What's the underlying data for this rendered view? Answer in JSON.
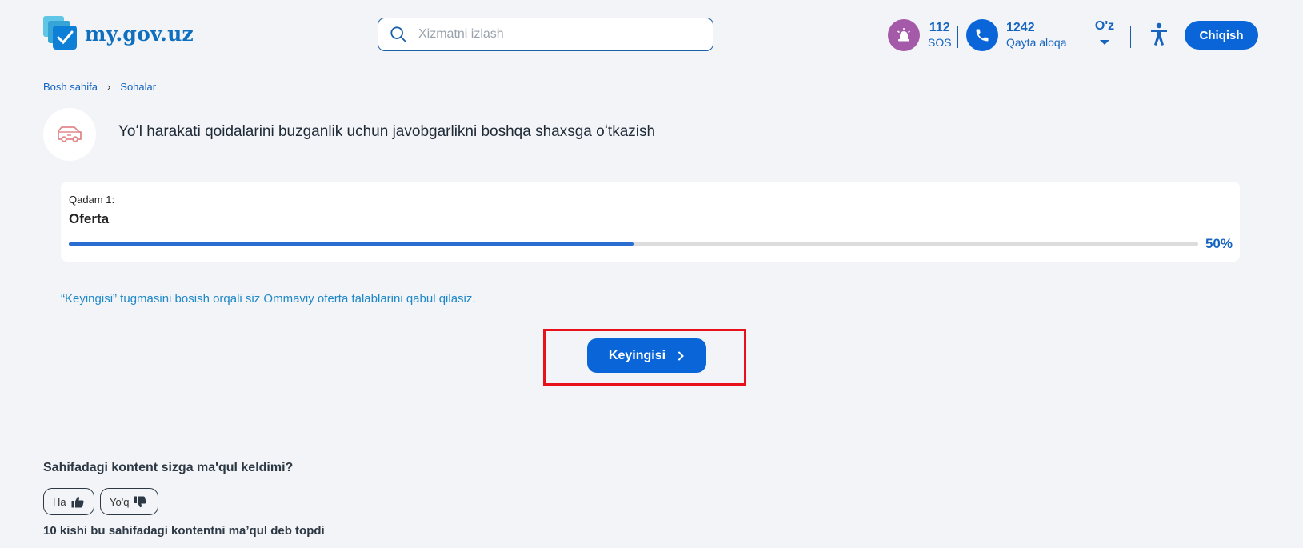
{
  "header": {
    "logo_text": "my.gov.uz",
    "search_placeholder": "Xizmatni izlash",
    "sos": {
      "number": "112",
      "label": "SOS"
    },
    "callback": {
      "number": "1242",
      "label": "Qayta aloqa"
    },
    "language": "O'z",
    "logout_label": "Chiqish"
  },
  "breadcrumb": {
    "home": "Bosh sahifa",
    "section": "Sohalar"
  },
  "page_title": "Yoʻl harakati qoidalarini buzganlik uchun javobgarlikni boshqa shaxsga oʻtkazish",
  "step": {
    "label": "Qadam 1:",
    "title": "Oferta",
    "progress_percent": 50,
    "progress_text": "50%"
  },
  "notice": "“Keyingisi” tugmasini bosish orqali siz Ommaviy oferta talablarini qabul qilasiz.",
  "next_button_label": "Keyingisi",
  "feedback": {
    "question": "Sahifadagi kontent sizga ma'qul keldimi?",
    "yes_label": "Ha",
    "no_label": "Yo'q",
    "count_text": "10 kishi bu sahifadagi kontentni maʼqul deb topdi"
  },
  "colors": {
    "primary": "#0a66d8",
    "sos": "#a45aa8",
    "highlight": "#e8101a",
    "link": "#1565c0"
  }
}
